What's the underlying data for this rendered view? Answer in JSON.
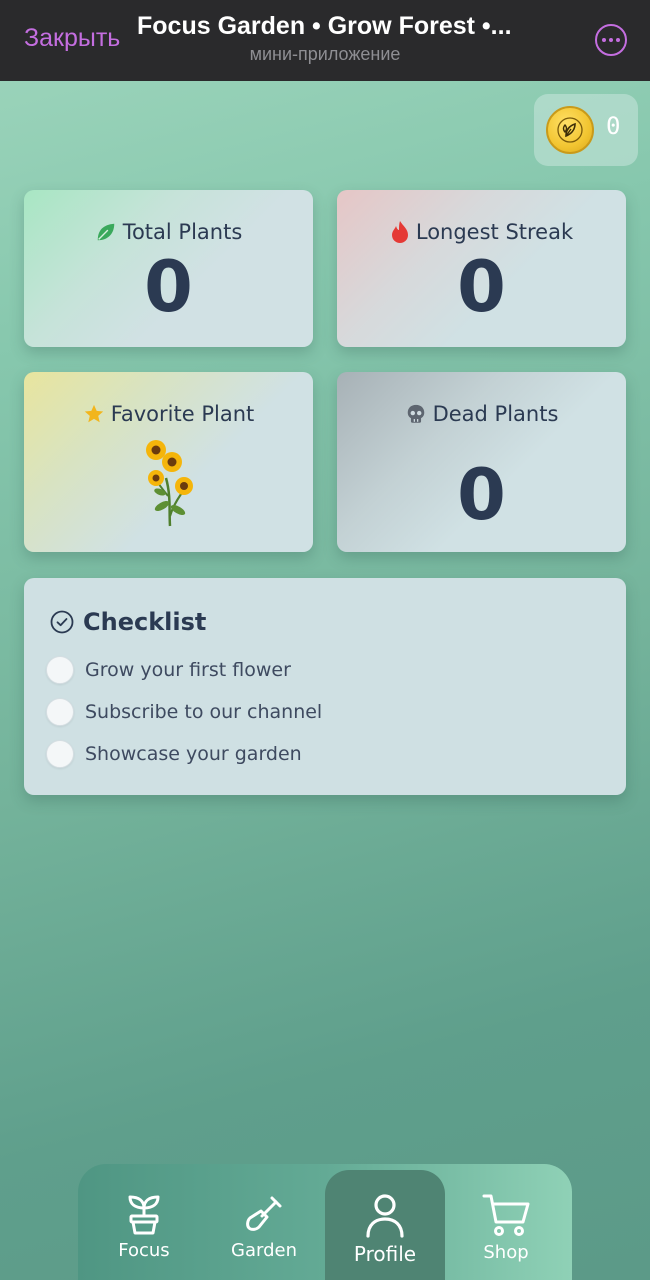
{
  "header": {
    "close_label": "Закрыть",
    "title": "Focus Garden • Grow Forest •...",
    "subtitle": "мини-приложение",
    "more_icon": "more-options-icon"
  },
  "coins": {
    "value": "0",
    "icon": "coin-leaf-icon"
  },
  "stats": {
    "total_plants": {
      "label": "Total Plants",
      "value": "0",
      "icon": "leaf-icon"
    },
    "longest_streak": {
      "label": "Longest Streak",
      "value": "0",
      "icon": "flame-icon"
    },
    "favorite_plant": {
      "label": "Favorite Plant",
      "icon": "star-icon",
      "plant_icon": "sunflower-icon"
    },
    "dead_plants": {
      "label": "Dead Plants",
      "value": "0",
      "icon": "skull-icon"
    }
  },
  "checklist": {
    "title": "Checklist",
    "items": [
      {
        "label": "Grow your first flower",
        "checked": false
      },
      {
        "label": "Subscribe to our channel",
        "checked": false
      },
      {
        "label": "Showcase your garden",
        "checked": false
      }
    ]
  },
  "nav": {
    "items": [
      {
        "label": "Focus",
        "icon": "sprout-pot-icon",
        "active": false
      },
      {
        "label": "Garden",
        "icon": "shovel-icon",
        "active": false
      },
      {
        "label": "Profile",
        "icon": "user-icon",
        "active": true
      },
      {
        "label": "Shop",
        "icon": "cart-icon",
        "active": false
      }
    ]
  },
  "colors": {
    "accent": "#c46ee0",
    "text_dark": "#2b3a52",
    "header_bg": "#2a2a2c",
    "active_tab": "#4f8473"
  }
}
